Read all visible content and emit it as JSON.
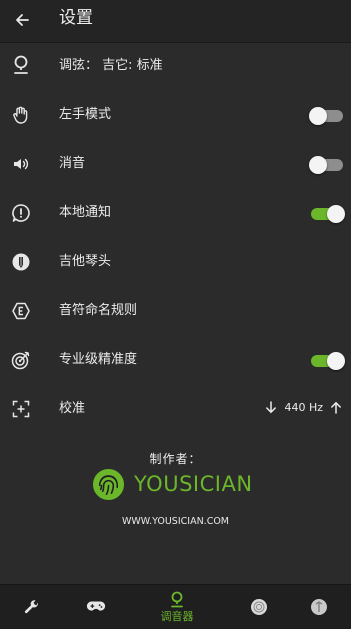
{
  "header": {
    "title": "设置"
  },
  "rows": [
    {
      "label": "调弦： 吉它: 标准"
    },
    {
      "label": "左手模式",
      "toggle": "off"
    },
    {
      "label": "消音",
      "toggle": "off"
    },
    {
      "label": "本地通知",
      "toggle": "on"
    },
    {
      "label": "吉他琴头"
    },
    {
      "label": "音符命名规则"
    },
    {
      "label": "专业级精准度",
      "toggle": "on"
    },
    {
      "label": "校准",
      "value": "440 Hz"
    }
  ],
  "credits": {
    "label": "制作者：",
    "brand": "YOUSICIAN",
    "url": "WWW.YOUSICIAN.COM"
  },
  "bottom_nav": {
    "active_label": "调音器",
    "items": [
      "wrench-icon",
      "gamepad-icon",
      "tuner-icon",
      "avatar-icon",
      "avatar-icon"
    ]
  },
  "colors": {
    "accent": "#6bb62a",
    "background": "#2b2b2b",
    "header": "#242424"
  }
}
